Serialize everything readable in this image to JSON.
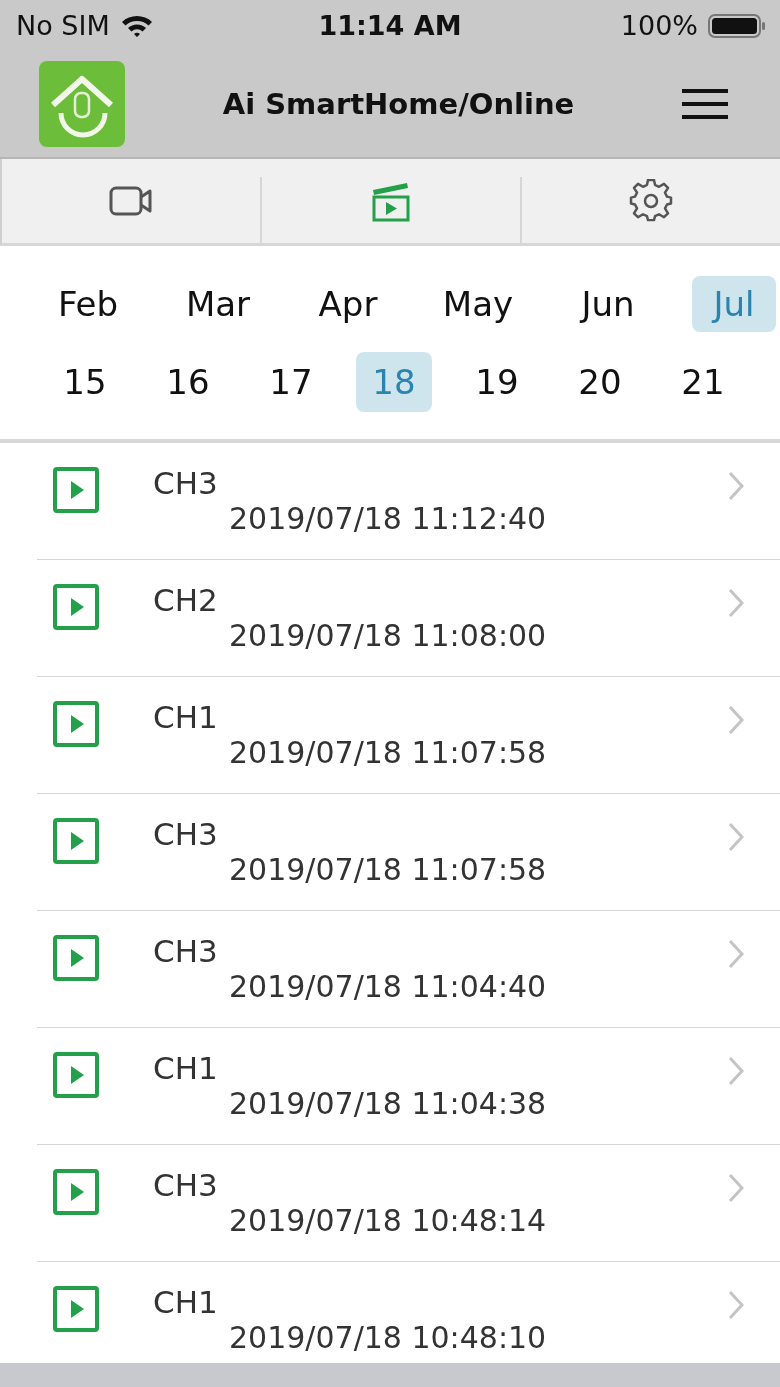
{
  "status_bar": {
    "carrier": "No SIM",
    "time": "11:14 AM",
    "battery": "100%"
  },
  "header": {
    "title": "Ai SmartHome/Online"
  },
  "tabs": [
    {
      "kind": "camera",
      "selected": false
    },
    {
      "kind": "playback",
      "selected": true
    },
    {
      "kind": "settings",
      "selected": false
    }
  ],
  "months": [
    {
      "label": "Feb",
      "selected": false
    },
    {
      "label": "Mar",
      "selected": false
    },
    {
      "label": "Apr",
      "selected": false
    },
    {
      "label": "May",
      "selected": false
    },
    {
      "label": "Jun",
      "selected": false
    },
    {
      "label": "Jul",
      "selected": true
    }
  ],
  "days": [
    {
      "label": "15",
      "selected": false
    },
    {
      "label": "16",
      "selected": false
    },
    {
      "label": "17",
      "selected": false
    },
    {
      "label": "18",
      "selected": true
    },
    {
      "label": "19",
      "selected": false
    },
    {
      "label": "20",
      "selected": false
    },
    {
      "label": "21",
      "selected": false
    }
  ],
  "recordings": [
    {
      "channel": "CH3",
      "datetime": "2019/07/18 11:12:40"
    },
    {
      "channel": "CH2",
      "datetime": "2019/07/18 11:08:00"
    },
    {
      "channel": "CH1",
      "datetime": "2019/07/18 11:07:58"
    },
    {
      "channel": "CH3",
      "datetime": "2019/07/18 11:07:58"
    },
    {
      "channel": "CH3",
      "datetime": "2019/07/18 11:04:40"
    },
    {
      "channel": "CH1",
      "datetime": "2019/07/18 11:04:38"
    },
    {
      "channel": "CH3",
      "datetime": "2019/07/18 10:48:14"
    },
    {
      "channel": "CH1",
      "datetime": "2019/07/18 10:48:10"
    }
  ]
}
